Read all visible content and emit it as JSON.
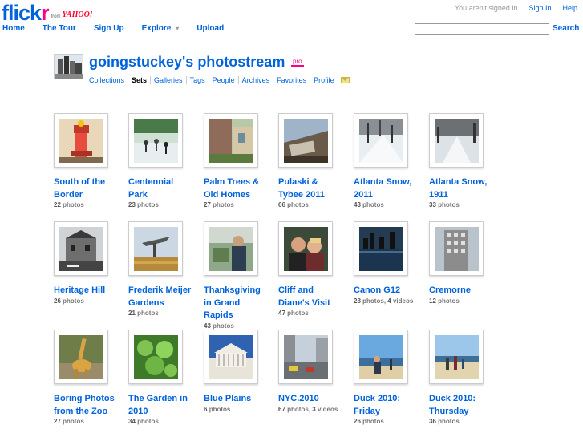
{
  "header": {
    "logo_flick": "flick",
    "logo_r": "r",
    "logo_from": "from",
    "logo_yahoo": "YAHOO!",
    "not_signed_in": "You aren't signed in",
    "sign_in": "Sign In",
    "help": "Help",
    "nav": {
      "home": "Home",
      "tour": "The Tour",
      "signup": "Sign Up",
      "explore": "Explore",
      "upload": "Upload"
    },
    "search_value": "",
    "search_label": "Search"
  },
  "profile": {
    "title": "goingstuckey's photostream",
    "pro": "pro",
    "subnav": [
      "Collections",
      "Sets",
      "Galleries",
      "Tags",
      "People",
      "Archives",
      "Favorites",
      "Profile"
    ],
    "active": "Sets"
  },
  "sets": [
    {
      "line1": "South of the",
      "line2": "Border",
      "line3": "",
      "photos": "22",
      "videos": ""
    },
    {
      "line1": "Centennial",
      "line2": "Park",
      "line3": "",
      "photos": "23",
      "videos": ""
    },
    {
      "line1": "Palm Trees &",
      "line2": "Old Homes",
      "line3": "",
      "photos": "27",
      "videos": ""
    },
    {
      "line1": "Pulaski &",
      "line2": "Tybee 2011",
      "line3": "",
      "photos": "66",
      "videos": ""
    },
    {
      "line1": "Atlanta Snow,",
      "line2": "2011",
      "line3": "",
      "photos": "43",
      "videos": ""
    },
    {
      "line1": "Atlanta Snow,",
      "line2": "1911",
      "line3": "",
      "photos": "33",
      "videos": ""
    },
    {
      "line1": "Heritage Hill",
      "line2": "",
      "line3": "",
      "photos": "26",
      "videos": ""
    },
    {
      "line1": "Frederik Meijer",
      "line2": "Gardens",
      "line3": "",
      "photos": "21",
      "videos": ""
    },
    {
      "line1": "Thanksgiving",
      "line2": "in Grand",
      "line3": "Rapids",
      "photos": "43",
      "videos": ""
    },
    {
      "line1": "Cliff and",
      "line2": "Diane's Visit",
      "line3": "",
      "photos": "47",
      "videos": ""
    },
    {
      "line1": "Canon G12",
      "line2": "",
      "line3": "",
      "photos": "28",
      "videos": "4"
    },
    {
      "line1": "Cremorne",
      "line2": "",
      "line3": "",
      "photos": "12",
      "videos": ""
    },
    {
      "line1": "Boring Photos",
      "line2": "from the Zoo",
      "line3": "",
      "photos": "27",
      "videos": ""
    },
    {
      "line1": "The Garden in",
      "line2": "2010",
      "line3": "",
      "photos": "34",
      "videos": ""
    },
    {
      "line1": "Blue Plains",
      "line2": "",
      "line3": "",
      "photos": "6",
      "videos": ""
    },
    {
      "line1": "NYC.2010",
      "line2": "",
      "line3": "",
      "photos": "67",
      "videos": "3"
    },
    {
      "line1": "Duck 2010:",
      "line2": "Friday",
      "line3": "",
      "photos": "26",
      "videos": ""
    },
    {
      "line1": "Duck 2010:",
      "line2": "Thursday",
      "line3": "",
      "photos": "36",
      "videos": ""
    }
  ],
  "labels": {
    "photos": "photos",
    "videos": "videos"
  }
}
